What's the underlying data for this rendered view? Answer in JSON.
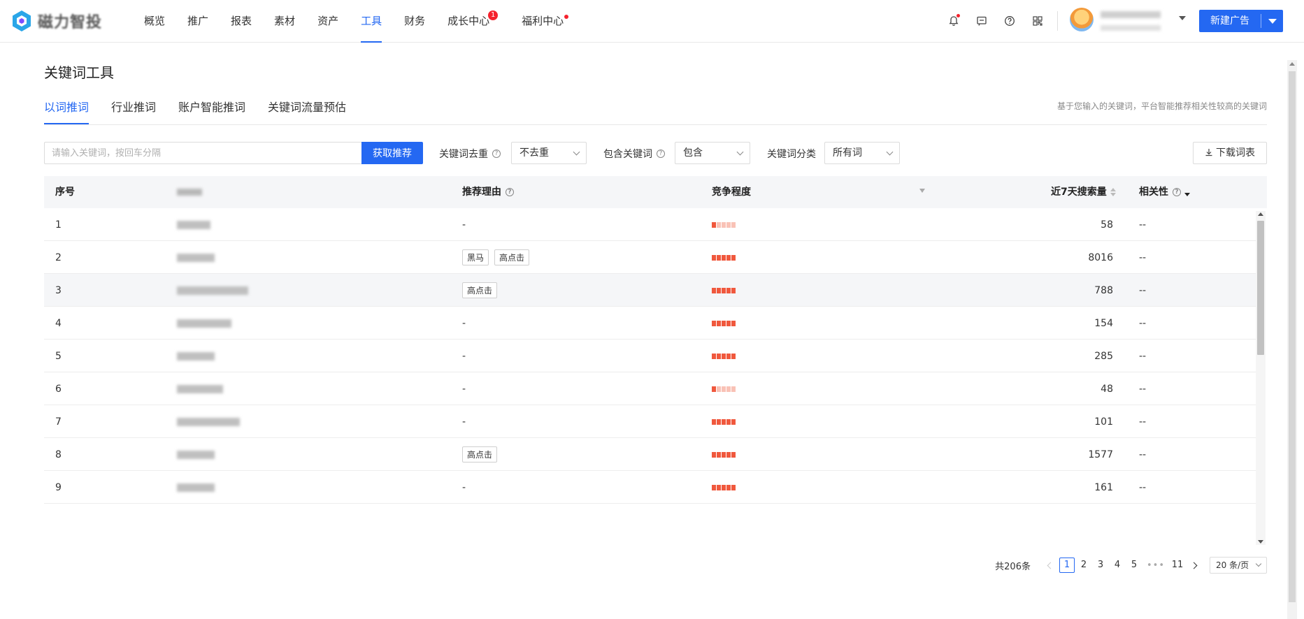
{
  "brand": {
    "name": "磁力智投",
    "color": "#2468f2"
  },
  "nav": {
    "items": [
      {
        "label": "概览"
      },
      {
        "label": "推广"
      },
      {
        "label": "报表"
      },
      {
        "label": "素材"
      },
      {
        "label": "资产"
      },
      {
        "label": "工具",
        "active": true
      },
      {
        "label": "财务"
      },
      {
        "label": "成长中心",
        "badge": "1"
      },
      {
        "label": "福利中心",
        "dot": true
      }
    ],
    "icons": [
      "bell-icon",
      "message-icon",
      "help-icon",
      "apps-icon"
    ],
    "new_ad_label": "新建广告"
  },
  "page": {
    "title": "关键词工具",
    "tabs": [
      "以词推词",
      "行业推词",
      "账户智能推词",
      "关键词流量预估"
    ],
    "active_tab": 0,
    "hint": "基于您输入的关键词，平台智能推荐相关性较高的关键词"
  },
  "filters": {
    "search_placeholder": "请输入关键词，按回车分隔",
    "search_button": "获取推荐",
    "dedupe_label": "关键词去重",
    "dedupe_value": "不去重",
    "include_label": "包含关键词",
    "include_value": "包含",
    "category_label": "关键词分类",
    "category_value": "所有词",
    "download_label": "下载词表",
    "help_glyph": "?"
  },
  "table": {
    "columns": {
      "index": "序号",
      "reason": "推荐理由",
      "competition": "竞争程度",
      "volume": "近7天搜索量",
      "relevance": "相关性"
    },
    "rows": [
      {
        "index": "1",
        "reason": "-",
        "tags": [],
        "competition": 1,
        "volume": "58",
        "relevance": "--"
      },
      {
        "index": "2",
        "reason": "",
        "tags": [
          "黑马",
          "高点击"
        ],
        "competition": 5,
        "volume": "8016",
        "relevance": "--"
      },
      {
        "index": "3",
        "reason": "",
        "tags": [
          "高点击"
        ],
        "competition": 5,
        "volume": "788",
        "relevance": "--"
      },
      {
        "index": "4",
        "reason": "-",
        "tags": [],
        "competition": 5,
        "volume": "154",
        "relevance": "--"
      },
      {
        "index": "5",
        "reason": "-",
        "tags": [],
        "competition": 5,
        "volume": "285",
        "relevance": "--"
      },
      {
        "index": "6",
        "reason": "-",
        "tags": [],
        "competition": 1,
        "volume": "48",
        "relevance": "--"
      },
      {
        "index": "7",
        "reason": "-",
        "tags": [],
        "competition": 5,
        "volume": "101",
        "relevance": "--"
      },
      {
        "index": "8",
        "reason": "",
        "tags": [
          "高点击"
        ],
        "competition": 5,
        "volume": "1577",
        "relevance": "--"
      },
      {
        "index": "9",
        "reason": "-",
        "tags": [],
        "competition": 5,
        "volume": "161",
        "relevance": "--"
      }
    ]
  },
  "pagination": {
    "total": "共206条",
    "pages": [
      "1",
      "2",
      "3",
      "4",
      "5"
    ],
    "current": "1",
    "ellipsis": "•••",
    "last": "11",
    "page_size": "20 条/页"
  }
}
